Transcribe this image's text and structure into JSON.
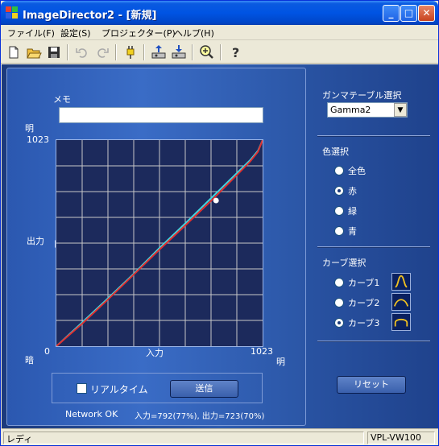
{
  "window": {
    "title": "ImageDirector2 - [新規]",
    "controls": {
      "minimize": "_",
      "maximize": "□",
      "close": "✕"
    }
  },
  "menu": [
    "ファイル(F)",
    "設定(S)",
    "プロジェクター(P)",
    "ヘルプ(H)"
  ],
  "toolbar": {
    "icons": [
      "new-file-icon",
      "open-folder-icon",
      "save-icon",
      "undo-icon",
      "redo-icon",
      "plug-icon",
      "upload-icon",
      "download-icon",
      "zoom-icon",
      "help-icon"
    ]
  },
  "editor": {
    "memo_label": "メモ",
    "memo_value": "",
    "axis": {
      "y_top_word": "明",
      "y_max": "1023",
      "y_label": "出力",
      "y_bottom_word": "暗",
      "x_min": "0",
      "x_label": "入力",
      "x_max": "1023",
      "x_right_word": "明"
    },
    "realtime_label": "リアルタイム",
    "realtime_checked": false,
    "send_label": "送信",
    "network_status": "Network OK",
    "readout": "入力=792(77%), 出力=723(70%)"
  },
  "chart_data": {
    "type": "line",
    "xlim": [
      0,
      1023
    ],
    "ylim": [
      0,
      1023
    ],
    "grid": true,
    "grid_divisions": 8,
    "series": [
      {
        "color": "#40d8e0",
        "x": [
          0,
          128,
          256,
          384,
          512,
          640,
          768,
          896,
          960,
          1000,
          1023
        ],
        "y": [
          0,
          118,
          238,
          360,
          488,
          610,
          735,
          860,
          922,
          970,
          1023
        ]
      },
      {
        "color": "#e03030",
        "x": [
          0,
          128,
          256,
          384,
          512,
          640,
          768,
          896,
          960,
          1000,
          1023
        ],
        "y": [
          0,
          112,
          232,
          356,
          480,
          600,
          722,
          850,
          915,
          965,
          1023
        ]
      }
    ],
    "marker": {
      "x": 792,
      "y": 723,
      "color": "#ffffff"
    }
  },
  "right": {
    "gamma_label": "ガンマテーブル選択",
    "gamma_selected": "Gamma2",
    "color_label": "色選択",
    "colors": [
      {
        "label": "全色",
        "checked": false
      },
      {
        "label": "赤",
        "checked": true
      },
      {
        "label": "緑",
        "checked": false
      },
      {
        "label": "青",
        "checked": false
      }
    ],
    "curve_label": "カーブ選択",
    "curves": [
      {
        "label": "カーブ1",
        "checked": false
      },
      {
        "label": "カーブ2",
        "checked": false
      },
      {
        "label": "カーブ3",
        "checked": true
      }
    ],
    "reset_label": "リセット"
  },
  "status": {
    "left": "レディ",
    "right": "VPL-VW100"
  },
  "accent": {
    "panel_blue": "#2b58b0",
    "graph_bg": "#1c2a5c",
    "titlebar_blue": "#0054e3"
  }
}
